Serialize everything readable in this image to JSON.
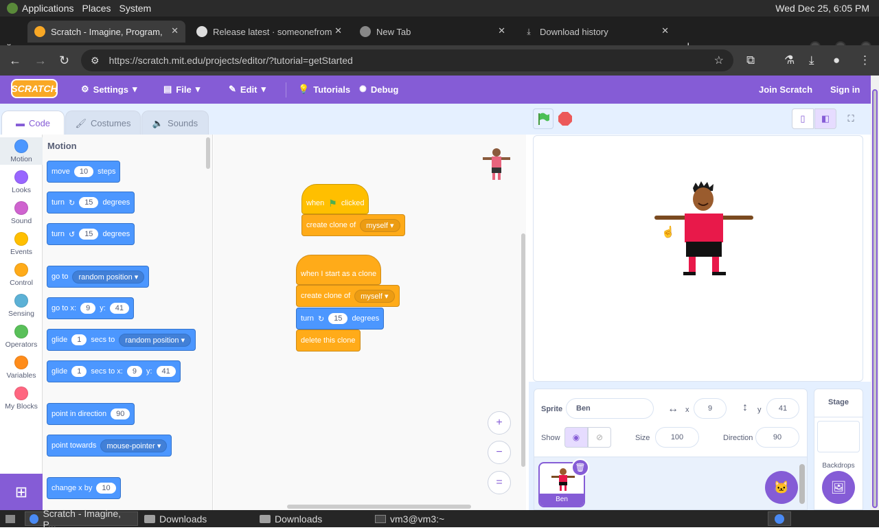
{
  "os": {
    "menus": [
      "Applications",
      "Places",
      "System"
    ],
    "clock": "Wed Dec 25,  6:05 PM"
  },
  "browser": {
    "tabs": [
      {
        "title": "Scratch - Imagine, Program,",
        "icon": "scratch-favicon"
      },
      {
        "title": "Release latest · someonefrom",
        "icon": "github-icon"
      },
      {
        "title": "New Tab",
        "icon": "chrome-icon"
      },
      {
        "title": "Download history",
        "icon": "download-icon"
      }
    ],
    "url": "https://scratch.mit.edu/projects/editor/?tutorial=getStarted"
  },
  "scratch_menu": {
    "logo": "SCRATCH",
    "settings": "Settings",
    "file": "File",
    "edit": "Edit",
    "tutorials": "Tutorials",
    "debug": "Debug",
    "join": "Join Scratch",
    "signin": "Sign in"
  },
  "editor_tabs": {
    "code": "Code",
    "costumes": "Costumes",
    "sounds": "Sounds"
  },
  "categories": [
    {
      "label": "Motion",
      "color": "#4c97ff"
    },
    {
      "label": "Looks",
      "color": "#9966ff"
    },
    {
      "label": "Sound",
      "color": "#cf63cf"
    },
    {
      "label": "Events",
      "color": "#ffbf00"
    },
    {
      "label": "Control",
      "color": "#ffab19"
    },
    {
      "label": "Sensing",
      "color": "#5cb1d6"
    },
    {
      "label": "Operators",
      "color": "#59c059"
    },
    {
      "label": "Variables",
      "color": "#ff8c1a"
    },
    {
      "label": "My Blocks",
      "color": "#ff6680"
    }
  ],
  "palette": {
    "title": "Motion",
    "move": {
      "a": "move",
      "v": "10",
      "b": "steps"
    },
    "turn_right": {
      "a": "turn",
      "v": "15",
      "b": "degrees"
    },
    "turn_left": {
      "a": "turn",
      "v": "15",
      "b": "degrees"
    },
    "goto": {
      "a": "go to",
      "dd": "random position"
    },
    "gotoxy": {
      "a": "go to x:",
      "x": "9",
      "b": "y:",
      "y": "41"
    },
    "glide": {
      "a": "glide",
      "v": "1",
      "b": "secs to",
      "dd": "random position"
    },
    "glidexy": {
      "a": "glide",
      "v": "1",
      "b": "secs to x:",
      "x": "9",
      "c": "y:",
      "y": "41"
    },
    "pointdir": {
      "a": "point in direction",
      "v": "90"
    },
    "pointtowards": {
      "a": "point towards",
      "dd": "mouse-pointer"
    },
    "changex": {
      "a": "change x by",
      "v": "10"
    }
  },
  "script": {
    "s1_hat": {
      "a": "when",
      "b": "clicked"
    },
    "s1_clone": {
      "a": "create clone of",
      "dd": "myself"
    },
    "s2_hat": "when I start as a clone",
    "s2_clone": {
      "a": "create clone of",
      "dd": "myself"
    },
    "s2_turn": {
      "a": "turn",
      "v": "15",
      "b": "degrees"
    },
    "s2_delete": "delete this clone"
  },
  "zoom": {
    "in": "+",
    "out": "−",
    "reset": "="
  },
  "sprite_info": {
    "sprite_label": "Sprite",
    "sprite_name": "Ben",
    "x_label": "x",
    "x_value": "9",
    "y_label": "y",
    "y_value": "41",
    "show_label": "Show",
    "size_label": "Size",
    "size_value": "100",
    "direction_label": "Direction",
    "direction_value": "90"
  },
  "sprite_list": [
    {
      "name": "Ben"
    }
  ],
  "stage_panel": {
    "title": "Stage",
    "backdrops": "Backdrops"
  },
  "taskbar": [
    {
      "label": "Scratch - Imagine, P..."
    },
    {
      "label": "Downloads"
    },
    {
      "label": "Downloads"
    },
    {
      "label": "vm3@vm3:~"
    }
  ]
}
